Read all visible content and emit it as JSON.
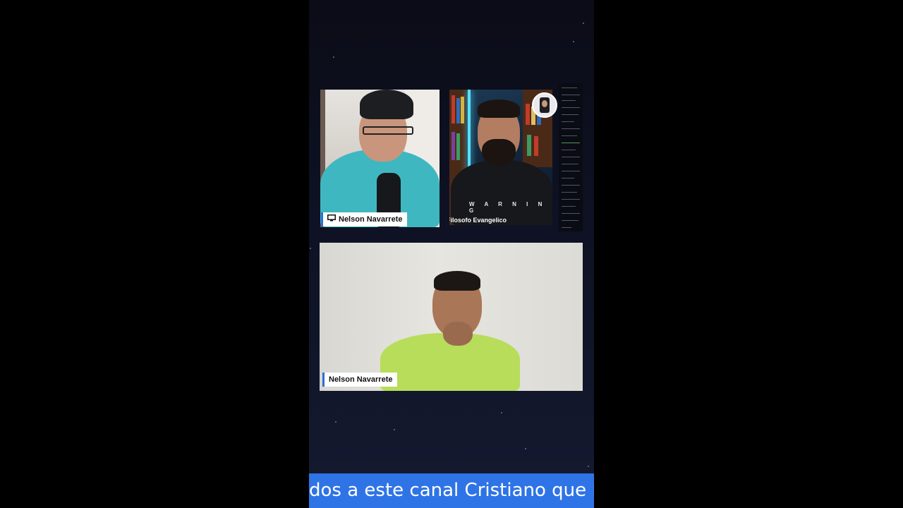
{
  "participants": [
    {
      "name": "Nelson Navarrete",
      "icon": "monitor-icon",
      "view": "screen-share"
    },
    {
      "name": "Filosofo Evangelico",
      "view": "camera"
    },
    {
      "name": "Nelson Navarrete",
      "view": "camera"
    }
  ],
  "shirt_print": "W A R N I N G",
  "ticker": {
    "text": "dos a este canal Cristiano que D"
  },
  "colors": {
    "accent": "#2f74e6",
    "background": "#0e1224",
    "label_bg": "#ffffff"
  }
}
